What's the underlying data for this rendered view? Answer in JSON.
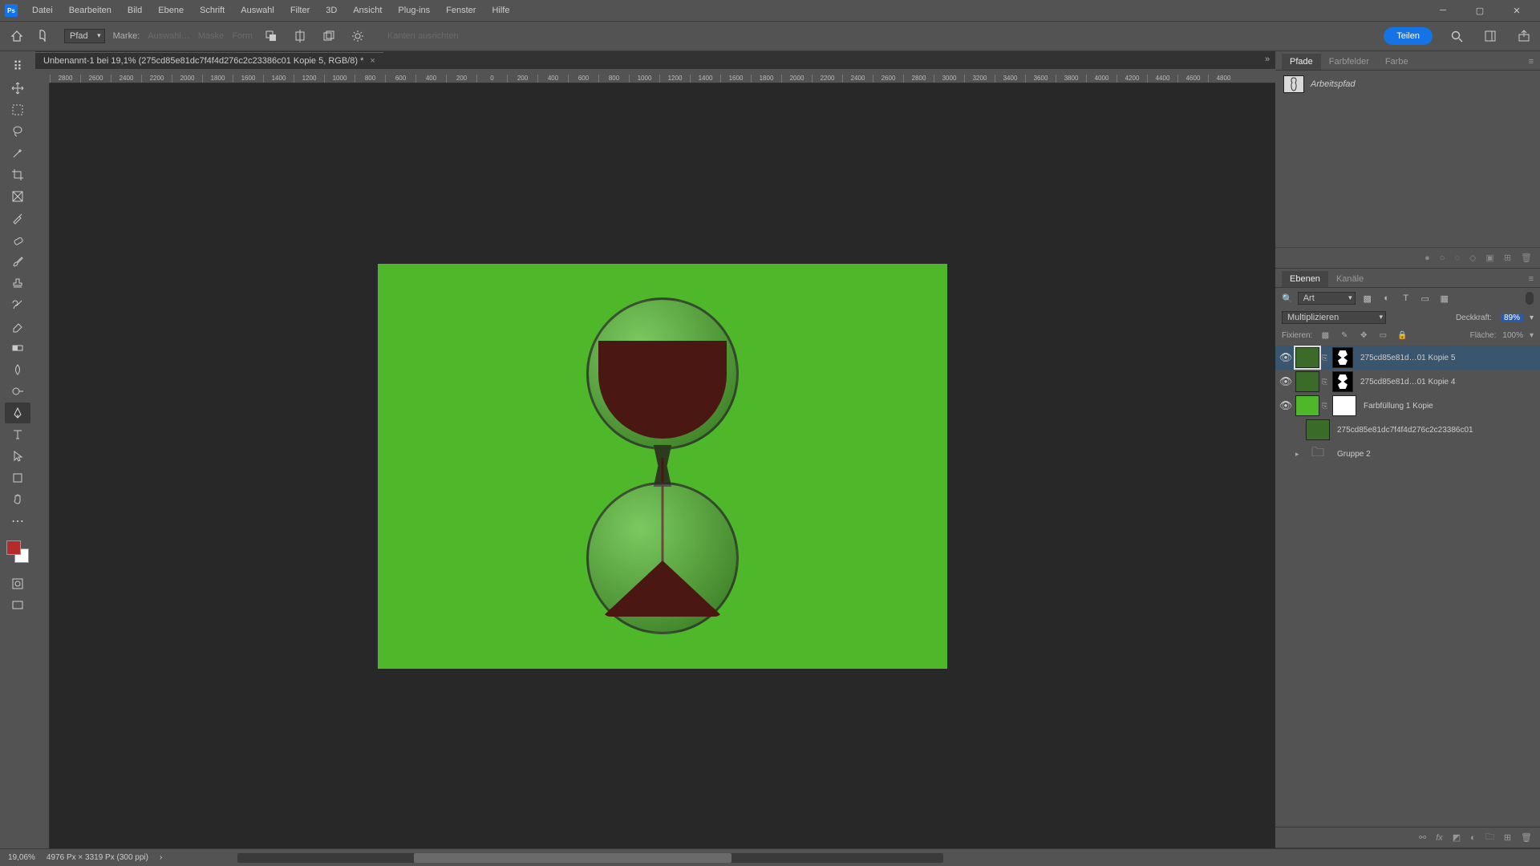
{
  "menu": {
    "items": [
      "Datei",
      "Bearbeiten",
      "Bild",
      "Ebene",
      "Schrift",
      "Auswahl",
      "Filter",
      "3D",
      "Ansicht",
      "Plug-ins",
      "Fenster",
      "Hilfe"
    ]
  },
  "optbar": {
    "mode_label": "Pfad",
    "make": "Marke:",
    "sel": "Auswahl…",
    "mask": "Maske",
    "shape": "Form",
    "align": "Kanten ausrichten",
    "share": "Teilen"
  },
  "doc": {
    "tab_title": "Unbenannt-1 bei 19,1% (275cd85e81dc7f4f4d276c2c23386c01 Kopie 5, RGB/8) *"
  },
  "ruler": [
    "2800",
    "2600",
    "2400",
    "2200",
    "2000",
    "1800",
    "1600",
    "1400",
    "1200",
    "1000",
    "800",
    "600",
    "400",
    "200",
    "0",
    "200",
    "400",
    "600",
    "800",
    "1000",
    "1200",
    "1400",
    "1600",
    "1800",
    "2000",
    "2200",
    "2400",
    "2600",
    "2800",
    "3000",
    "3200",
    "3400",
    "3600",
    "3800",
    "4000",
    "4200",
    "4400",
    "4600",
    "4800"
  ],
  "panels": {
    "paths": {
      "tabs": [
        "Pfade",
        "Farbfelder",
        "Farbe"
      ],
      "row": "Arbeitspfad"
    },
    "layers": {
      "tabs": [
        "Ebenen",
        "Kanäle"
      ],
      "filter_label": "Art",
      "blend": "Multiplizieren",
      "opacity_label": "Deckkraft:",
      "opacity_value": "89%",
      "lock_label": "Fixieren:",
      "fill_label": "Fläche:",
      "fill_value": "100%",
      "items": [
        {
          "name": "275cd85e81d…01 Kopie 5",
          "visible": true,
          "mask": true,
          "selected": true
        },
        {
          "name": "275cd85e81d…01 Kopie 4",
          "visible": true,
          "mask": true
        },
        {
          "name": "Farbfüllung 1 Kopie",
          "visible": true,
          "mask": true,
          "fill": "green"
        },
        {
          "name": "275cd85e81dc7f4f4d276c2c23386c01",
          "visible": false
        },
        {
          "name": "Gruppe 2",
          "visible": false,
          "group": true
        }
      ]
    }
  },
  "status": {
    "zoom": "19,06%",
    "info": "4976 Px × 3319 Px (300 ppi)"
  }
}
